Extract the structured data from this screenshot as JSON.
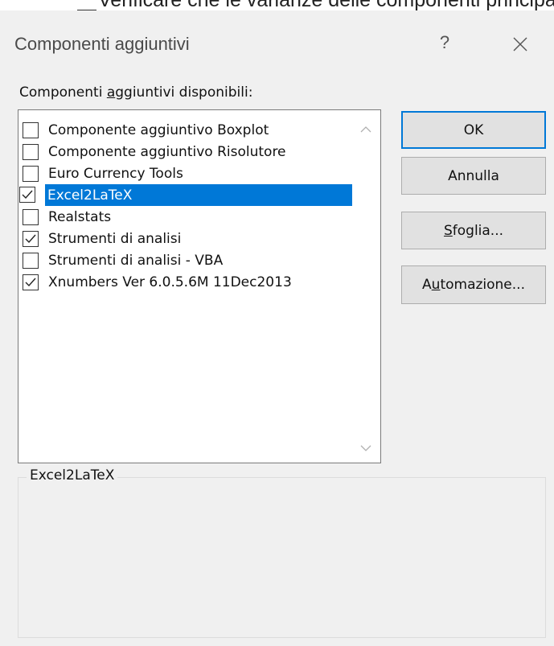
{
  "background": {
    "partial_text": "Verificare che le varianze delle componenti principali e"
  },
  "dialog": {
    "title": "Componenti aggiuntivi",
    "help_icon": "?",
    "close_icon": "close-icon"
  },
  "list": {
    "label_prefix": "Componenti ",
    "label_accel": "a",
    "label_suffix": "ggiuntivi disponibili:",
    "selected_index": 3,
    "items": [
      {
        "label": "Componente aggiuntivo Boxplot",
        "checked": false
      },
      {
        "label": "Componente aggiuntivo Risolutore",
        "checked": false
      },
      {
        "label": "Euro Currency Tools",
        "checked": false
      },
      {
        "label": "Excel2LaTeX",
        "checked": true
      },
      {
        "label": "Realstats",
        "checked": false
      },
      {
        "label": "Strumenti di analisi",
        "checked": true
      },
      {
        "label": "Strumenti di analisi - VBA",
        "checked": false
      },
      {
        "label": "Xnumbers Ver 6.0.5.6M 11Dec2013",
        "checked": true
      }
    ]
  },
  "buttons": {
    "ok": "OK",
    "annulla": "Annulla",
    "sfoglia_accel": "S",
    "sfoglia_rest": "foglia...",
    "automazione_pre": "A",
    "automazione_accel": "u",
    "automazione_rest": "tomazione..."
  },
  "description": {
    "group_label": "Excel2LaTeX"
  },
  "colors": {
    "selection": "#0078d7",
    "dialog_bg": "#f0f0f0",
    "button_bg": "#e1e1e1"
  }
}
